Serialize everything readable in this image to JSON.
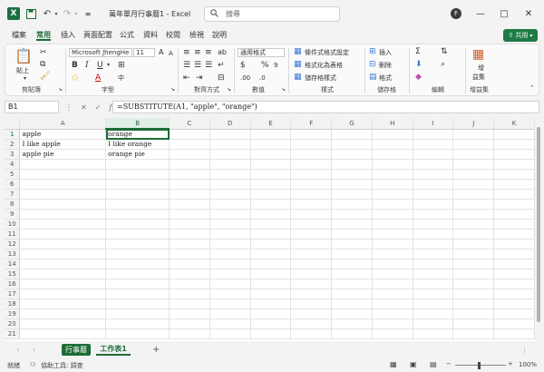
{
  "window": {
    "title": "萬年單月行事曆1 - Excel",
    "search_placeholder": "搜尋",
    "avatar_initial": "F"
  },
  "menu": {
    "tabs": [
      "檔案",
      "常用",
      "插入",
      "頁面配置",
      "公式",
      "資料",
      "校閱",
      "檢視",
      "說明"
    ],
    "active_tab": "常用",
    "share_label": "共用"
  },
  "ribbon": {
    "paste_label": "貼上",
    "font_name": "Microsoft JhengHe",
    "font_size": "11",
    "number_format": "通用格式",
    "conditional_format": "條件式格式設定",
    "format_as_table": "格式化為表格",
    "cell_styles": "儲存格樣式",
    "insert_label": "插入",
    "delete_label": "刪除",
    "format_label": "格式",
    "addins_line1": "增",
    "addins_line2": "益集",
    "group_labels": {
      "clipboard": "剪貼簿",
      "font": "字型",
      "alignment": "對齊方式",
      "number": "數值",
      "styles": "樣式",
      "cells": "儲存格",
      "editing": "編輯",
      "addins": "增益集"
    }
  },
  "formula_bar": {
    "name_box": "B1",
    "fx": "fx",
    "formula": "=SUBSTITUTE(A1, \"apple\", \"orange\")"
  },
  "grid": {
    "columns": [
      "A",
      "B",
      "C",
      "D",
      "E",
      "F",
      "G",
      "H",
      "I",
      "J",
      "K"
    ],
    "selected_column": "B",
    "selected_row": 1,
    "row_count": 21,
    "cells": [
      [
        "apple",
        "orange"
      ],
      [
        "I like apple",
        "I like orange"
      ],
      [
        "apple pie",
        "orange pie"
      ]
    ]
  },
  "sheets": {
    "tabs": [
      "行事曆",
      "工作表1"
    ],
    "active": "工作表1",
    "add_symbol": "+"
  },
  "status": {
    "ready": "就緒",
    "accessibility": "協助工具: 調查",
    "zoom": "100%"
  },
  "colors": {
    "accent": "#1e6b36",
    "share": "#1e7b45",
    "excel_brand": "#1d6f42"
  }
}
